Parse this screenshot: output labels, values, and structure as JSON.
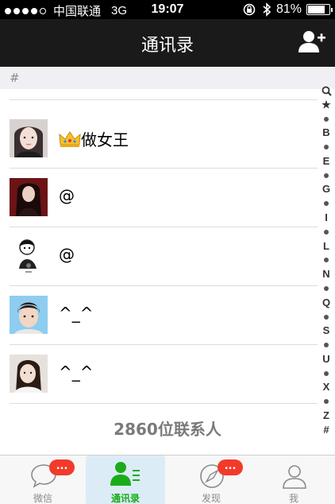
{
  "status_bar": {
    "carrier": "中国联通",
    "network": "3G",
    "time": "19:07",
    "battery_text": "81%",
    "battery_level": 0.81,
    "signal_bars_filled": 4,
    "signal_bars_total": 5
  },
  "header": {
    "title": "通讯录",
    "add_icon": "add-contact-icon"
  },
  "section": {
    "letter": "#"
  },
  "contacts": [
    {
      "name": "做女王",
      "prefix_icon": "crown-icon"
    },
    {
      "name": "@"
    },
    {
      "name": "@"
    },
    {
      "name": "^_^"
    },
    {
      "name": "^_^"
    }
  ],
  "contact_count": "2860位联系人",
  "index_bar": [
    "search",
    "★",
    "•",
    "B",
    "•",
    "E",
    "•",
    "G",
    "•",
    "I",
    "•",
    "L",
    "•",
    "N",
    "•",
    "Q",
    "•",
    "S",
    "•",
    "U",
    "•",
    "X",
    "•",
    "Z",
    "#"
  ],
  "tabs": [
    {
      "label": "微信",
      "icon": "chat-bubble-icon",
      "badge": "...",
      "active": false
    },
    {
      "label": "通讯录",
      "icon": "contacts-icon",
      "active": true
    },
    {
      "label": "发现",
      "icon": "compass-icon",
      "badge": "...",
      "active": false
    },
    {
      "label": "我",
      "icon": "person-icon",
      "active": false
    }
  ],
  "colors": {
    "header_bg": "#1a1a1a",
    "active_tab": "#1aad19",
    "badge": "#f23a2b"
  }
}
